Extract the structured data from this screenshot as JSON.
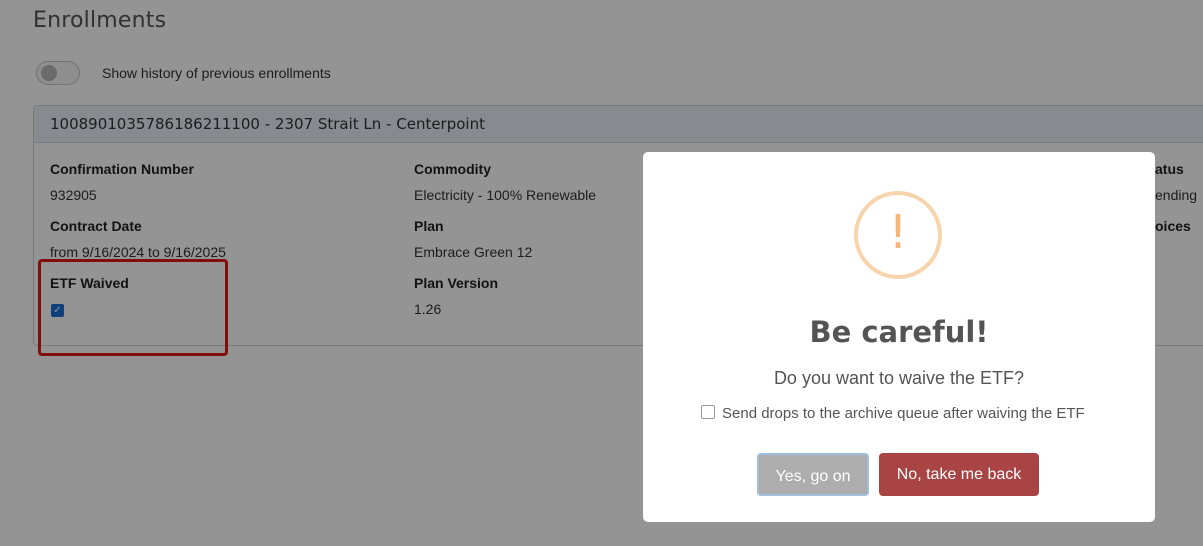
{
  "page": {
    "title": "Enrollments",
    "history_toggle_label": "Show history of previous enrollments"
  },
  "enrollment": {
    "header": "1008901035786186211100 - 2307 Strait Ln - Centerpoint",
    "fields": {
      "confirmation_number_label": "Confirmation Number",
      "confirmation_number": "932905",
      "contract_date_label": "Contract Date",
      "contract_date": "from 9/16/2024 to 9/16/2025",
      "etf_waived_label": "ETF Waived",
      "etf_waived": true,
      "commodity_label": "Commodity",
      "commodity": "Electricity - 100% Renewable",
      "plan_label": "Plan",
      "plan": "Embrace Green 12",
      "plan_version_label": "Plan Version",
      "plan_version": "1.26",
      "status_label_partial": "atus",
      "status_partial": "ending",
      "invoices_label_partial": "oices"
    }
  },
  "modal": {
    "icon": "exclamation-warning-icon",
    "icon_color": "#f6b57a",
    "title": "Be careful!",
    "text": "Do you want to waive the ETF?",
    "checkbox_label": "Send drops to the archive queue after waiving the ETF",
    "checkbox_checked": false,
    "confirm_label": "Yes, go on",
    "cancel_label": "No, take me back",
    "cancel_color": "#a94444"
  },
  "annotation": {
    "highlight_color": "#e01818"
  }
}
